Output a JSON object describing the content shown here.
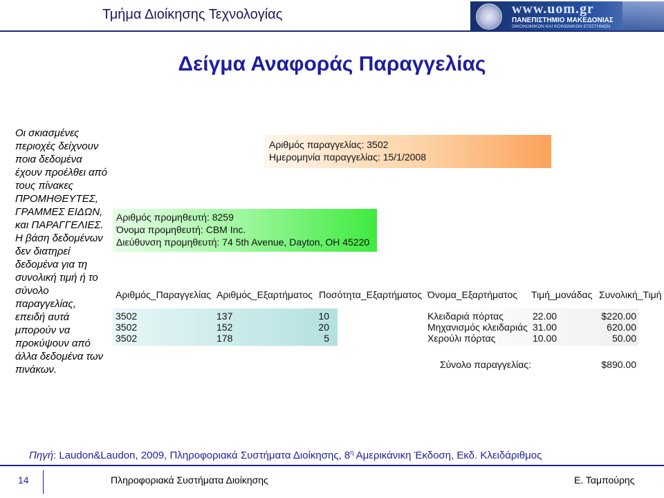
{
  "header": {
    "title": "Τμήμα Διοίκησης Τεχνολογίας",
    "logo": {
      "url_text": "www.uom.gr",
      "name": "ΠΑΝΕΠΙΣΤΗΜΙΟ ΜΑΚΕΔΟΝΙΑΣ",
      "subtitle": "ΟΙΚΟΝΟΜΙΚΩΝ ΚΑΙ ΚΟΙΝΩΝΙΚΩΝ ΕΠΙΣΤΗΜΩΝ"
    }
  },
  "slide_title": "Δείγμα Αναφοράς Παραγγελίας",
  "note": "Οι σκιασμένες περιοχές δείχνουν ποια δεδομένα έχουν προέλθει από τους πίνακες ΠΡΟΜΗΘΕΥΤΕΣ, ΓΡΑΜΜΕΣ ΕΙΔΩΝ, και ΠΑΡΑΓΓΕΛΙΕΣ. Η βάση δεδομένων δεν διατηρεί δεδομένα για τη συνολική τιμή ή το σύνολο παραγγελίας, επειδή αυτά μπορούν να προκύψουν από άλλα δεδομένα των πινάκων.",
  "order": {
    "number_line": "Αριθμός παραγγελίας: 3502",
    "date_line": "Ημερομηνία παραγγελίας: 15/1/2008"
  },
  "vendor": {
    "number_line": "Αριθμός προμηθευτή: 8259",
    "name_line": "Όνομα προμηθευτή: CBM Inc.",
    "address_line": "Διεύθυνση προμηθευτή: 74 5th Avenue, Dayton, OH 45220"
  },
  "table": {
    "headers": [
      "Αριθμός_Παραγγελίας",
      "Αριθμός_Εξαρτήματος",
      "Ποσότητα_Εξαρτήματος",
      "Όνομα_Εξαρτήματος",
      "Τιμή_μονάδας",
      "Συνολική_Τιμή"
    ],
    "rows": [
      {
        "order": "3502",
        "part": "137",
        "qty": "10",
        "name": "Κλειδαριά πόρτας",
        "unit": "22.00",
        "total": "$220.00"
      },
      {
        "order": "3502",
        "part": "152",
        "qty": "20",
        "name": "Μηχανισμός κλειδαριάς",
        "unit": "31.00",
        "total": "620.00"
      },
      {
        "order": "3502",
        "part": "178",
        "qty": "5",
        "name": "Χερούλι πόρτας",
        "unit": "10.00",
        "total": "50.00"
      }
    ],
    "order_total_label": "Σύνολο παραγγελίας:",
    "order_total_value": "$890.00"
  },
  "source": {
    "label": "Πηγή",
    "text_before_sup": ": Laudon&Laudon, 2009, Πληροφοριακά Συστήματα Διοίκησης, 8",
    "sup": "η",
    "text_after_sup": " Αμερικάνικη Έκδοση, Εκδ. Κλειδάριθμος"
  },
  "footer": {
    "page_number": "14",
    "course": "Πληροφοριακά Συστήματα Διοίκησης",
    "author": "Ε. Ταμπούρης"
  }
}
